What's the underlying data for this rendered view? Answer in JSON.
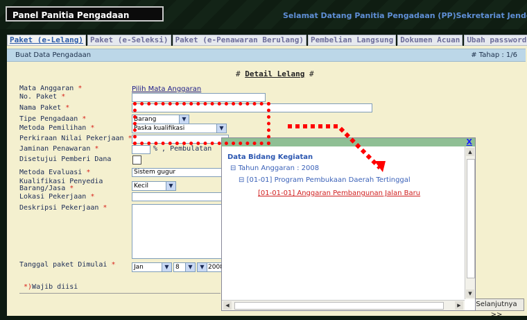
{
  "header": {
    "panel_title": "Panel Panitia Pengadaan",
    "welcome": "Selamat Datang Panitia Pengadaan (PP)Sekretariat Jendera"
  },
  "tabs": [
    {
      "label": "Paket (e-Lelang)"
    },
    {
      "label": "Paket (e-Seleksi)"
    },
    {
      "label": "Paket (e-Penawaran Berulang)"
    },
    {
      "label": "Pembelian Langsung"
    },
    {
      "label": "Dokumen Acuan"
    },
    {
      "label": "Ubah password"
    }
  ],
  "subheader": {
    "left": "Buat Data Pengadaan",
    "right": "# Tahap : 1/6"
  },
  "section_title": "Detail Lelang",
  "form": {
    "labels": [
      "Mata Anggaran",
      "No. Paket",
      "Nama Paket",
      "Tipe Pengadaan",
      "Metoda Pemilihan",
      "Perkiraan Nilai Pekerjaan",
      "Jaminan Penawaran",
      "Disetujui Pemberi Dana",
      "Metoda Evaluasi",
      "Kualifikasi Penyedia",
      "Barang/Jasa",
      "Lokasi Pekerjaan",
      "Deskripsi Pekerjaan",
      "Tanggal paket Dimulai"
    ],
    "pilih_link": "Pilih Mata Anggaran",
    "tipe_value": "Barang",
    "metoda_value": "Paska kualifikasi",
    "jaminan_text": "% , Pembulatan",
    "evaluasi_value": "Sistem gugur",
    "kualifikasi_value": "Kecil",
    "tanggal_bulan": "Jan",
    "tanggal_hari": "8",
    "tanggal_tahun": "2008",
    "wajib_mark": "*)",
    "wajib_text": "Wajib diisi"
  },
  "next_button": "Selanjutnya >>",
  "popup": {
    "close": "X",
    "title": "Data Bidang Kegiatan",
    "tree": [
      "Tahun Anggaran : 2008",
      "[01-01] Program Pembukaan Daerah Tertinggal",
      "[01-01-01] Anggaran Pembangunan Jalan Baru"
    ]
  },
  "colors": {
    "header_bg": "#132417",
    "content_bg": "#f4f0cf",
    "header_bar": "#bcd7e8",
    "required": "#d8241c",
    "annotation": "#ff0000",
    "popup_head": "#8fbf94"
  }
}
